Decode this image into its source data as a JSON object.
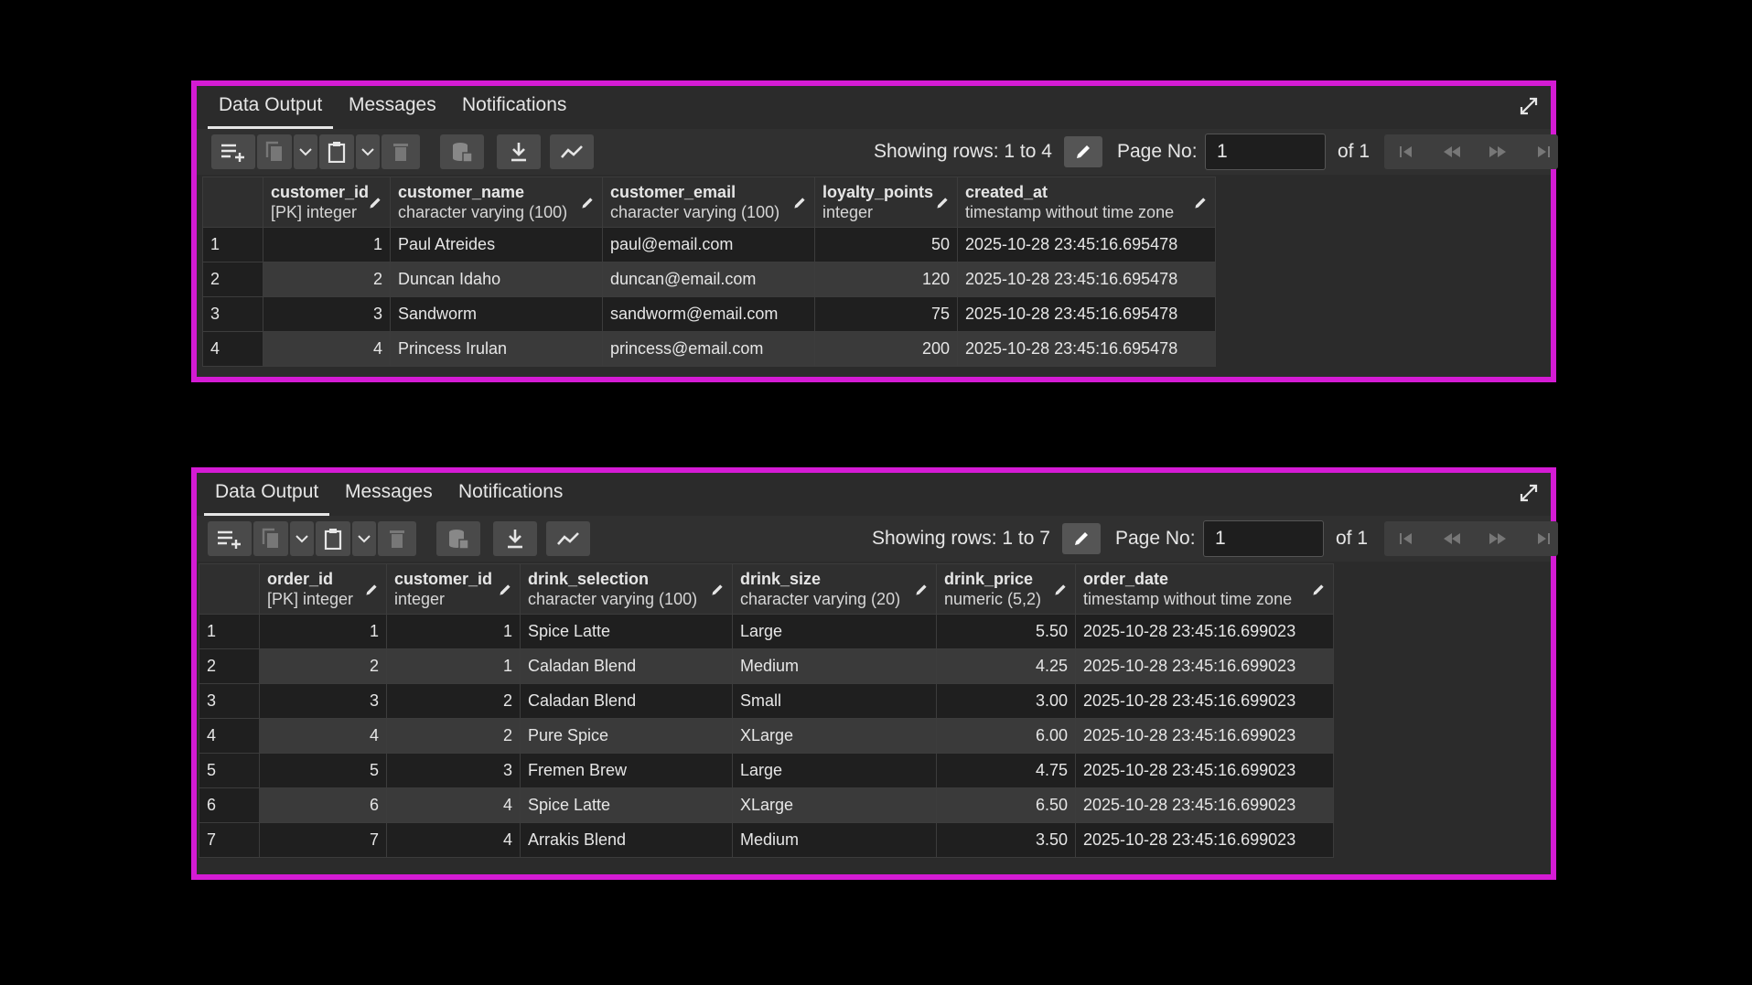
{
  "panels": [
    {
      "tabs": [
        "Data Output",
        "Messages",
        "Notifications"
      ],
      "showing_rows": "Showing rows: 1 to 4",
      "page_label": "Page No:",
      "page_value": "1",
      "page_of": "of 1",
      "columns": [
        {
          "name": "customer_id",
          "type": "[PK] integer"
        },
        {
          "name": "customer_name",
          "type": "character varying (100)"
        },
        {
          "name": "customer_email",
          "type": "character varying (100)"
        },
        {
          "name": "loyalty_points",
          "type": "integer"
        },
        {
          "name": "created_at",
          "type": "timestamp without time zone"
        }
      ],
      "rows": [
        [
          "1",
          "1",
          "Paul Atreides",
          "paul@email.com",
          "50",
          "2025-10-28 23:45:16.695478"
        ],
        [
          "2",
          "2",
          "Duncan Idaho",
          "duncan@email.com",
          "120",
          "2025-10-28 23:45:16.695478"
        ],
        [
          "3",
          "3",
          "Sandworm",
          "sandworm@email.com",
          "75",
          "2025-10-28 23:45:16.695478"
        ],
        [
          "4",
          "4",
          "Princess Irulan",
          "princess@email.com",
          "200",
          "2025-10-28 23:45:16.695478"
        ]
      ]
    },
    {
      "tabs": [
        "Data Output",
        "Messages",
        "Notifications"
      ],
      "showing_rows": "Showing rows: 1 to 7",
      "page_label": "Page No:",
      "page_value": "1",
      "page_of": "of 1",
      "columns": [
        {
          "name": "order_id",
          "type": "[PK] integer"
        },
        {
          "name": "customer_id",
          "type": "integer"
        },
        {
          "name": "drink_selection",
          "type": "character varying (100)"
        },
        {
          "name": "drink_size",
          "type": "character varying (20)"
        },
        {
          "name": "drink_price",
          "type": "numeric (5,2)"
        },
        {
          "name": "order_date",
          "type": "timestamp without time zone"
        }
      ],
      "rows": [
        [
          "1",
          "1",
          "1",
          "Spice Latte",
          "Large",
          "5.50",
          "2025-10-28 23:45:16.699023"
        ],
        [
          "2",
          "2",
          "1",
          "Caladan Blend",
          "Medium",
          "4.25",
          "2025-10-28 23:45:16.699023"
        ],
        [
          "3",
          "3",
          "2",
          "Caladan Blend",
          "Small",
          "3.00",
          "2025-10-28 23:45:16.699023"
        ],
        [
          "4",
          "4",
          "2",
          "Pure Spice",
          "XLarge",
          "6.00",
          "2025-10-28 23:45:16.699023"
        ],
        [
          "5",
          "5",
          "3",
          "Fremen Brew",
          "Large",
          "4.75",
          "2025-10-28 23:45:16.699023"
        ],
        [
          "6",
          "6",
          "4",
          "Spice Latte",
          "XLarge",
          "6.50",
          "2025-10-28 23:45:16.699023"
        ],
        [
          "7",
          "7",
          "4",
          "Arrakis Blend",
          "Medium",
          "3.50",
          "2025-10-28 23:45:16.699023"
        ]
      ]
    }
  ],
  "colors": {
    "border": "#d41bd4",
    "panel_bg": "#2b2b2b",
    "page_bg": "#000000"
  }
}
